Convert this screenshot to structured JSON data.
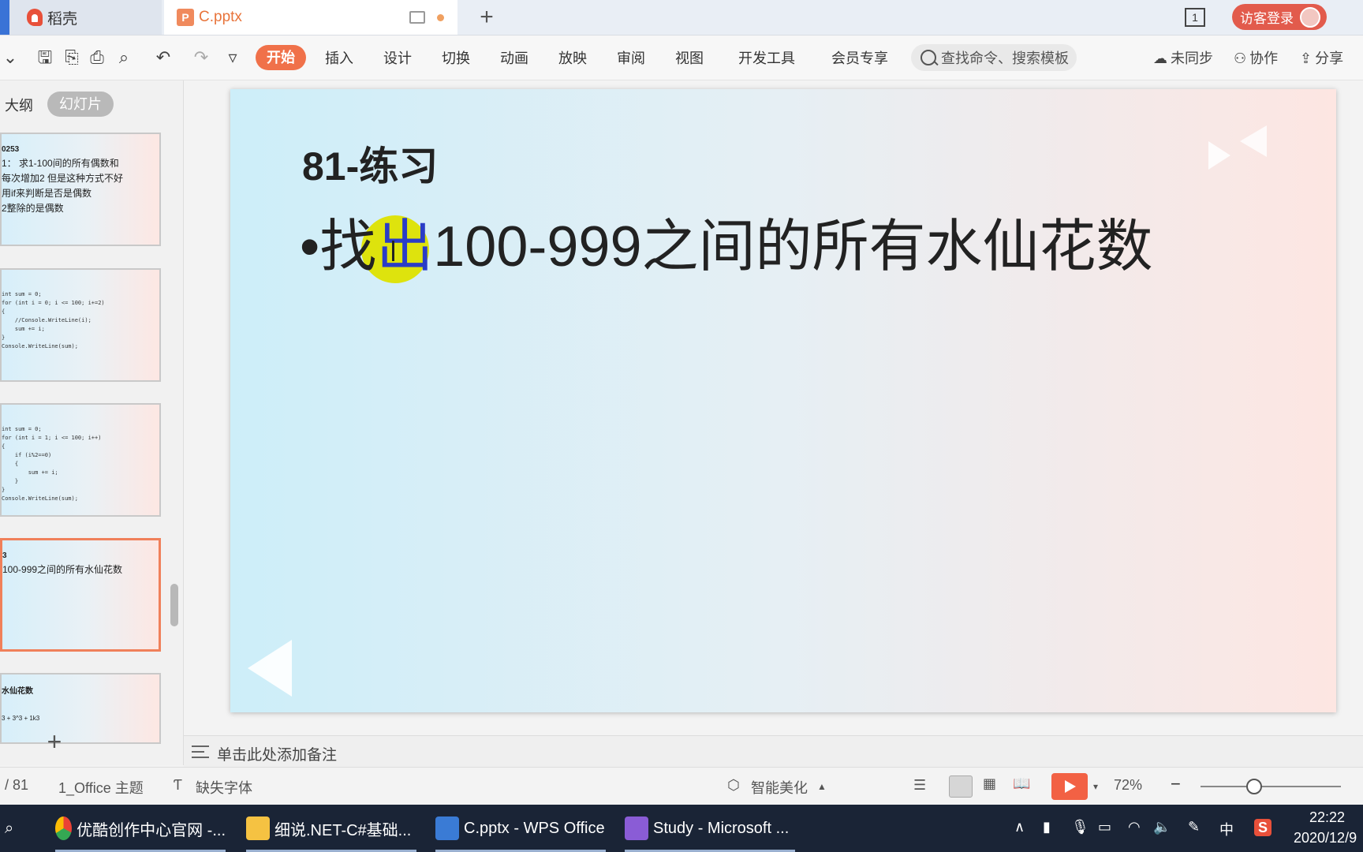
{
  "tabs": {
    "home_label": "稻壳",
    "doc_label": "C.pptx",
    "doc_icon": "P",
    "new_tab": "+",
    "window_count": "1",
    "login_label": "访客登录"
  },
  "ribbon": {
    "menus": [
      "开始",
      "插入",
      "设计",
      "切换",
      "动画",
      "放映",
      "审阅",
      "视图",
      "开发工具",
      "会员专享"
    ],
    "search_placeholder": "查找命令、搜索模板",
    "sync_label": "未同步",
    "collab_label": "协作",
    "share_label": "分享"
  },
  "left_panel": {
    "outline_label": "大纲",
    "slides_label": "幻灯片",
    "thumb1": {
      "line1": "0253",
      "line2": "1：  求1-100间的所有偶数和",
      "line3": "每次增加2 但是这种方式不好",
      "line4": "用if来判断是否是偶数",
      "line5": "2整除的是偶数"
    },
    "thumb2_code": "int sum = 0;\nfor (int i = 0; i <= 100; i+=2)\n{\n    //Console.WriteLine(i);\n    sum += i;\n}\nConsole.WriteLine(sum);",
    "thumb3_code": "int sum = 0;\nfor (int i = 1; i <= 100; i++)\n{\n    if (i%2==0)\n    {\n        sum += i;\n    }\n}\nConsole.WriteLine(sum);",
    "thumb4": {
      "line1": "3",
      "line2": "100-999之间的所有水仙花数"
    },
    "thumb5": {
      "line1": "水仙花数",
      "line2": "3 + 3^3 + 1k3"
    },
    "add_slide": "+"
  },
  "slide": {
    "title": "81-练习",
    "bullet_dot": "•",
    "bullet_part1": "找",
    "bullet_selected": "出",
    "bullet_part2": "100-999之间的所有水仙花数"
  },
  "notes": {
    "placeholder": "单击此处添加备注"
  },
  "status": {
    "page": "/ 81",
    "theme": "1_Office 主题",
    "missing_font": "缺失字体",
    "beautify": "智能美化",
    "zoom": "72%",
    "zoom_minus": "−"
  },
  "taskbar": {
    "items": [
      "优酷创作中心官网 -...",
      "细说.NET-C#基础...",
      "C.pptx - WPS Office",
      "Study - Microsoft ..."
    ],
    "ime": "中",
    "time": "22:22",
    "date": "2020/12/9"
  },
  "colors": {
    "accent": "#f0714a",
    "login": "#e25b4c",
    "play": "#f26144",
    "taskbar": "#1a2436",
    "selected_text": "#2a3cc7",
    "highlight": "#dee200"
  }
}
